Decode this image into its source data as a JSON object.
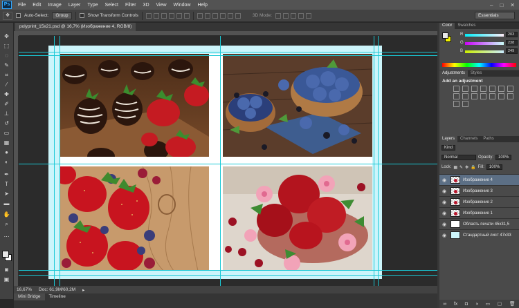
{
  "menubar": {
    "logo": "Ps",
    "items": [
      "File",
      "Edit",
      "Image",
      "Layer",
      "Type",
      "Select",
      "Filter",
      "3D",
      "View",
      "Window",
      "Help"
    ],
    "window_controls": [
      "–",
      "□",
      "✕"
    ]
  },
  "options_bar": {
    "auto_select_label": "Auto-Select:",
    "auto_select_value": "Group",
    "show_transform_label": "Show Transform Controls",
    "mode_3d_label": "3D Mode:",
    "workspace": "Essentials"
  },
  "document": {
    "tab_title": "polyprint_15x21.psd @ 16,7% (Изображение 4, RGB/8)",
    "zoom": "16,67%",
    "doc_size": "Doc: 61,9M/60,2M"
  },
  "bottom_tabs": [
    "Mini Bridge",
    "Timeline"
  ],
  "color_panel": {
    "tabs": [
      "Color",
      "Swatches"
    ],
    "channels": [
      {
        "label": "R",
        "value": "203"
      },
      {
        "label": "G",
        "value": "238"
      },
      {
        "label": "B",
        "value": "249"
      }
    ],
    "fg_color": "#e8e8e8",
    "bg_color": "#f3f300"
  },
  "adjustments_panel": {
    "tabs": [
      "Adjustments",
      "Styles"
    ],
    "title": "Add an adjustment"
  },
  "layers_panel": {
    "tabs": [
      "Layers",
      "Channels",
      "Paths"
    ],
    "kind": "Kind",
    "blend_mode": "Normal",
    "opacity_label": "Opacity:",
    "opacity": "100%",
    "lock_label": "Lock:",
    "fill_label": "Fill:",
    "fill": "100%",
    "layers": [
      {
        "name": "Изображение 4",
        "selected": true
      },
      {
        "name": "Изображение 3",
        "selected": false
      },
      {
        "name": "Изображение 2",
        "selected": false
      },
      {
        "name": "Изображение 1",
        "selected": false
      },
      {
        "name": "Область печати 45х31,5",
        "selected": false
      },
      {
        "name": "Стандартный лист 47х33",
        "selected": false
      }
    ]
  },
  "colors": {
    "guide": "#19c9d6",
    "page_bleed": "#ccf5fb",
    "selected_layer": "#5c6f85"
  }
}
